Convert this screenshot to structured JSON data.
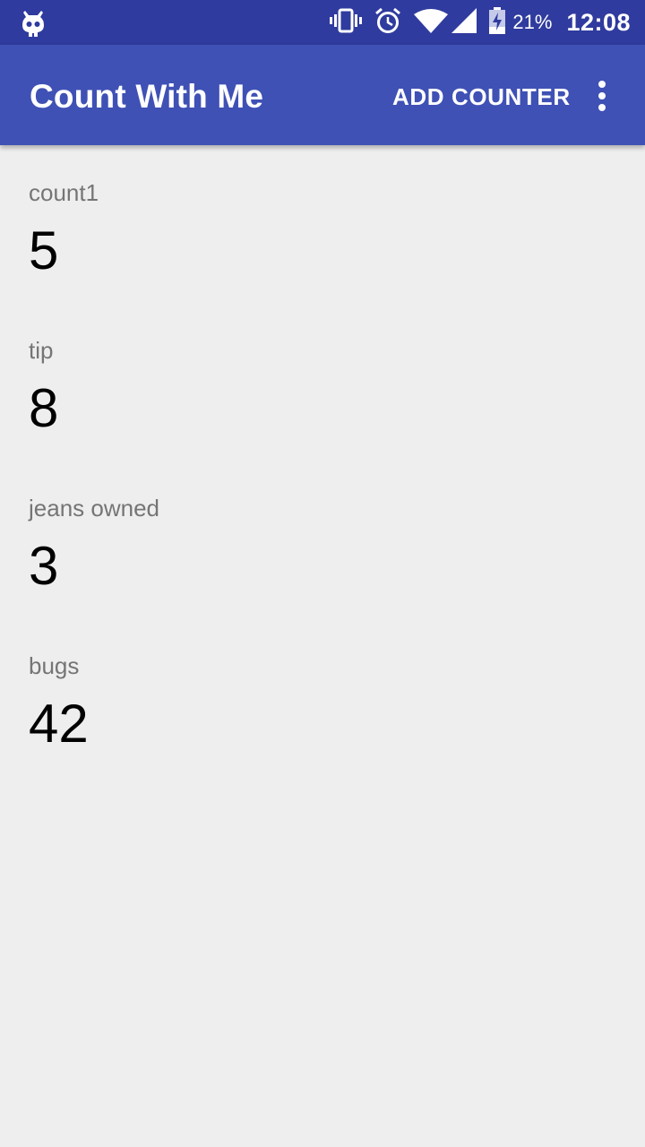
{
  "status_bar": {
    "notification_icon": "cyanogen-mod-icon",
    "icons": [
      "vibrate-icon",
      "alarm-icon",
      "wifi-icon",
      "signal-icon",
      "battery-charging-icon"
    ],
    "battery_percent": "21%",
    "time": "12:08",
    "background_color": "#2f3b9e"
  },
  "app_bar": {
    "title": "Count With Me",
    "action_label": "ADD COUNTER",
    "overflow_icon": "more-vert-icon",
    "background_color": "#3f51b5"
  },
  "counters": [
    {
      "label": "count1",
      "value": "5"
    },
    {
      "label": "tip",
      "value": "8"
    },
    {
      "label": "jeans owned",
      "value": "3"
    },
    {
      "label": "bugs",
      "value": "42"
    }
  ]
}
